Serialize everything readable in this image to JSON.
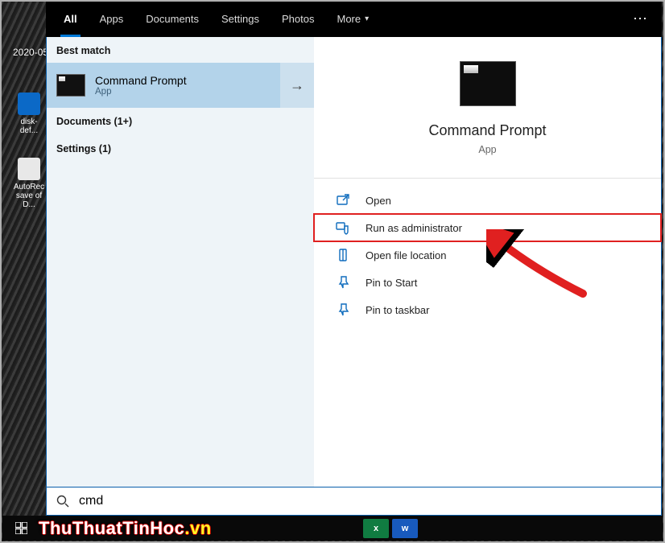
{
  "tabs": {
    "all": "All",
    "apps": "Apps",
    "documents": "Documents",
    "settings": "Settings",
    "photos": "Photos",
    "more": "More"
  },
  "left": {
    "best_header": "Best match",
    "best_title": "Command Prompt",
    "best_sub": "App",
    "cat_documents": "Documents (1+)",
    "cat_settings": "Settings (1)"
  },
  "preview": {
    "title": "Command Prompt",
    "sub": "App"
  },
  "actions": {
    "open": "Open",
    "run_admin": "Run as administrator",
    "open_location": "Open file location",
    "pin_start": "Pin to Start",
    "pin_taskbar": "Pin to taskbar"
  },
  "search": {
    "value": "cmd"
  },
  "desktop": {
    "date": "2020-05",
    "icon1": "disk-def...",
    "icon2": "AutoRec\nsave of D..."
  },
  "watermark": {
    "main": "ThuThuatTinHoc",
    "suffix": ".vn"
  },
  "taskbar_apps": {
    "excel": "x",
    "word": "w"
  }
}
